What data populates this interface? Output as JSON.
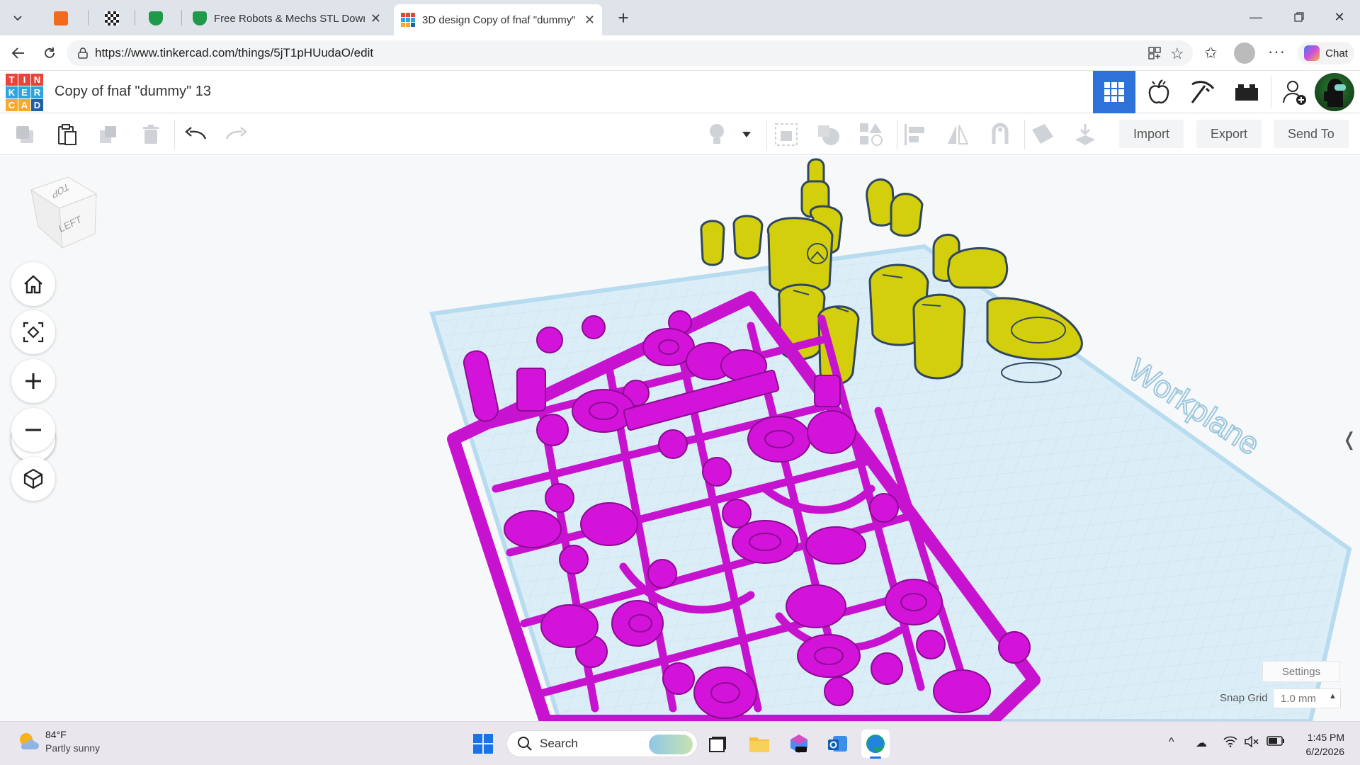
{
  "browser": {
    "tabs": [
      {
        "title": "",
        "icon": "orange-app-icon"
      },
      {
        "title": "",
        "icon": "checkered-app-icon"
      },
      {
        "title": "",
        "icon": "green-shield-icon"
      },
      {
        "title": "Free Robots & Mechs STL Downlo",
        "icon": "green-shield-icon"
      },
      {
        "title": "3D design Copy of fnaf \"dummy\"",
        "icon": "tinkercad-icon"
      }
    ],
    "new_tab": "+",
    "url": "https://www.tinkercad.com/things/5jT1pHUudaO/edit",
    "chat_label": "Chat"
  },
  "app": {
    "logo_letters": [
      "T",
      "I",
      "N",
      "K",
      "E",
      "R",
      "C",
      "A",
      "D"
    ],
    "logo_colors": [
      "#e9433c",
      "#e9433c",
      "#e9433c",
      "#2ea3e2",
      "#2ea3e2",
      "#2ea3e2",
      "#f7a928",
      "#f7a928",
      "#1f5fa7"
    ],
    "design_title": "Copy of fnaf \"dummy\" 13",
    "accent": "#2d72d9"
  },
  "toolbar": {
    "import_label": "Import",
    "export_label": "Export",
    "send_to_label": "Send To"
  },
  "viewport": {
    "view_cube_top": "TOP",
    "view_cube_left": "LEFT",
    "workplane_label": "Workplane",
    "settings_label": "Settings",
    "snap_grid_label": "Snap Grid",
    "snap_grid_value": "1.0 mm",
    "shape_colors": {
      "yellow": "#d6d30a",
      "magenta": "#d414dc",
      "workplane": "#d7ecf7"
    }
  },
  "taskbar": {
    "temperature": "84°F",
    "weather": "Partly sunny",
    "search_placeholder": "Search",
    "time": "1:45 PM",
    "date": "6/2/2026"
  }
}
